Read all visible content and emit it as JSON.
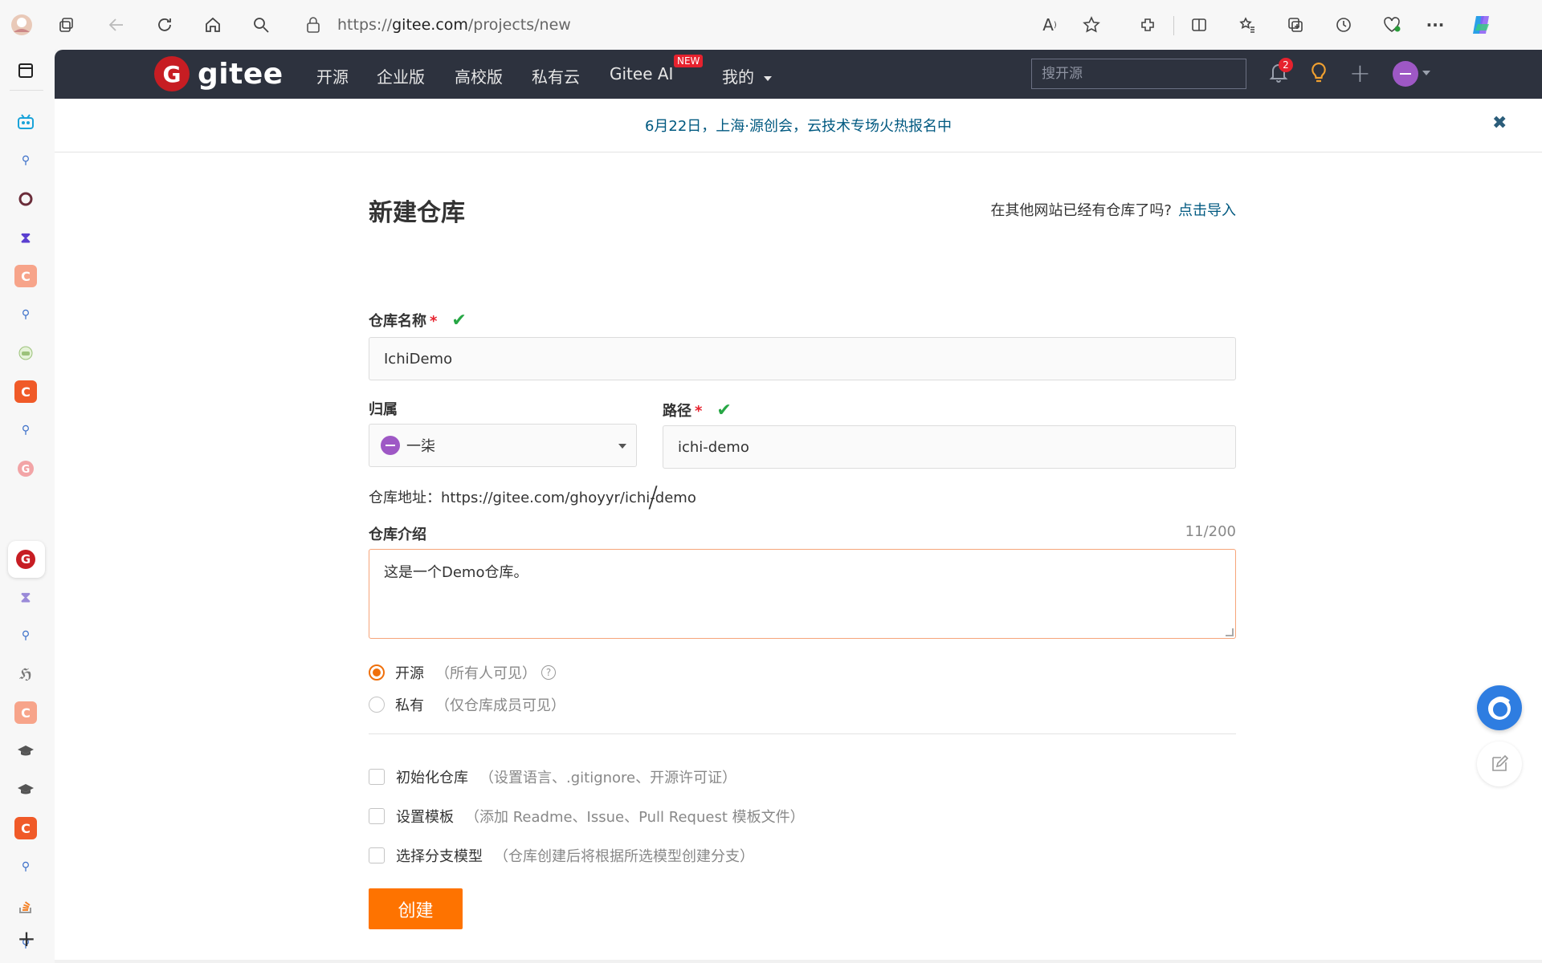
{
  "browser": {
    "url_prefix": "https://",
    "url_host": "gitee.com",
    "url_path": "/projects/new"
  },
  "header": {
    "logo_mark": "G",
    "logo_text": "gitee",
    "nav": [
      "开源",
      "企业版",
      "高校版",
      "私有云",
      "Gitee AI",
      "我的"
    ],
    "new_badge": "NEW",
    "search_placeholder": "搜开源",
    "notification_count": "2"
  },
  "announcement": {
    "text": "6月22日，上海·源创会，云技术专场火热报名中",
    "close": "✖"
  },
  "form": {
    "title": "新建仓库",
    "import_prompt": "在其他网站已经有仓库了吗?",
    "import_link": "点击导入",
    "repo_name_label": "仓库名称",
    "repo_name_value": "IchiDemo",
    "owner_label": "归属",
    "owner_value": "一柒",
    "path_label": "路径",
    "path_value": "ichi-demo",
    "slash": "/",
    "address_label": "仓库地址：",
    "address_value": "https://gitee.com/ghoyyr/ichi-demo",
    "desc_label": "仓库介绍",
    "desc_counter": "11/200",
    "desc_value": "这是一个Demo仓库。",
    "visibility": [
      {
        "label": "开源",
        "hint": "（所有人可见）",
        "selected": true
      },
      {
        "label": "私有",
        "hint": "（仅仓库成员可见）",
        "selected": false
      }
    ],
    "options": [
      {
        "label": "初始化仓库",
        "hint": "（设置语言、.gitignore、开源许可证）"
      },
      {
        "label": "设置模板",
        "hint": "（添加 Readme、Issue、Pull Request 模板文件）"
      },
      {
        "label": "选择分支模型",
        "hint": "（仓库创建后将根据所选模型创建分支）"
      }
    ],
    "submit": "创建"
  },
  "colors": {
    "brand_red": "#c71d23",
    "accent_orange": "#fe7300",
    "link_blue": "#005980",
    "header_bg": "#2d323e"
  }
}
